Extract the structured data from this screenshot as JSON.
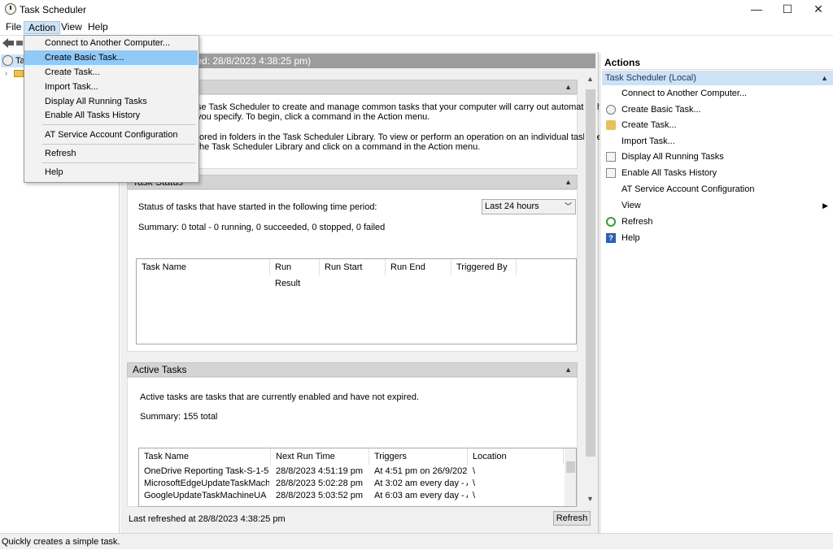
{
  "window": {
    "title": "Task Scheduler",
    "controls": {
      "minimize": "—",
      "maximize": "☐",
      "close": "✕"
    }
  },
  "menubar": {
    "file": "File",
    "action": "Action",
    "view": "View",
    "help": "Help"
  },
  "tree": {
    "root_label": "Ta"
  },
  "action_menu": {
    "items": [
      "Connect to Another Computer...",
      "Create Basic Task...",
      "Create Task...",
      "Import Task...",
      "Display All Running Tasks",
      "Enable All Tasks History",
      "AT Service Account Configuration",
      "Refresh",
      "Help"
    ]
  },
  "center": {
    "header": "ary (Last refreshed: 28/8/2023 4:38:25 pm)",
    "overview": {
      "title": "cheduler",
      "line1": "se Task Scheduler to create and manage common tasks that your computer will carry out automatically at",
      "line2": "you specify. To begin, click a command in the Action menu.",
      "line3": "tored in folders in the Task Scheduler Library. To view or perform an operation on an individual task, select",
      "line4": "the Task Scheduler Library and click on a command in the Action menu."
    },
    "task_status": {
      "title": "Task Status",
      "period_label": "Status of tasks that have started in the following time period:",
      "period_value": "Last 24 hours",
      "summary": "Summary: 0 total - 0 running, 0 succeeded, 0 stopped, 0 failed",
      "columns": [
        "Task Name",
        "Run Result",
        "Run Start",
        "Run End",
        "Triggered By"
      ]
    },
    "active_tasks": {
      "title": "Active Tasks",
      "description": "Active tasks are tasks that are currently enabled and have not expired.",
      "summary": "Summary: 155 total",
      "columns": [
        "Task Name",
        "Next Run Time",
        "Triggers",
        "Location"
      ],
      "rows": [
        [
          "OneDrive Reporting Task-S-1-5-21...",
          "28/8/2023 4:51:19 pm",
          "At 4:51 pm on 26/9/2022...",
          "\\"
        ],
        [
          "MicrosoftEdgeUpdateTaskMachine...",
          "28/8/2023 5:02:28 pm",
          "At 3:02 am every day - A...",
          "\\"
        ],
        [
          "GoogleUpdateTaskMachineUA",
          "28/8/2023 5:03:52 pm",
          "At 6:03 am every day - A...",
          "\\"
        ]
      ]
    },
    "footer": {
      "last_refreshed": "Last refreshed at 28/8/2023 4:38:25 pm",
      "refresh_button": "Refresh"
    }
  },
  "actions_pane": {
    "title": "Actions",
    "group": "Task Scheduler (Local)",
    "items": [
      "Connect to Another Computer...",
      "Create Basic Task...",
      "Create Task...",
      "Import Task...",
      "Display All Running Tasks",
      "Enable All Tasks History",
      "AT Service Account Configuration",
      "View",
      "Refresh",
      "Help"
    ]
  },
  "statusbar": {
    "text": "Quickly creates a simple task."
  },
  "colors": {
    "highlight": "#91c9f7",
    "group_header": "#cfe1f5",
    "header_gray": "#9c9c9c"
  }
}
